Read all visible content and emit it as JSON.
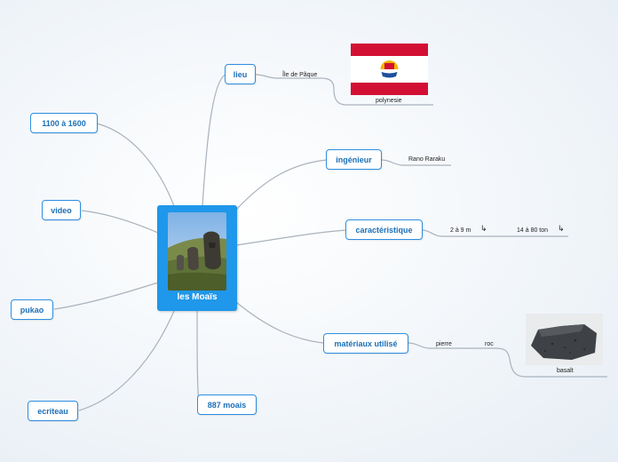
{
  "map": {
    "central_title": "les Moaïs",
    "nodes": {
      "lieu": "lieu",
      "date": "1100 à 1600",
      "ingenieur": "ingénieur",
      "video": "video",
      "caracteristique": "caractéristique",
      "pukao": "pukao",
      "materiaux": "matériaux utilisé",
      "ecriteau": "ecriteau",
      "moais_count": "887 moais"
    },
    "leaves": {
      "lieu_place": "Île de Pâque",
      "flag_caption": "polynesie",
      "ingenieur_name": "Rano Raraku",
      "height": "2 à 9 m",
      "weight": "14 à 80 ton",
      "material_type": "pierre",
      "material_sub": "roc",
      "rock_caption": "basalt"
    },
    "link_color": "#a9b2bc",
    "accent": "#2d8ee0",
    "central_color": "#1f97ea"
  }
}
